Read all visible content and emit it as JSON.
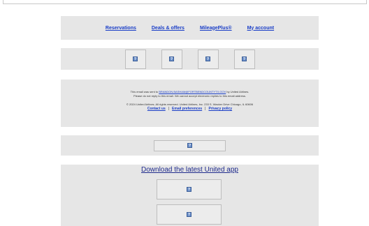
{
  "nav": {
    "items": [
      "Reservations",
      "Deals & offers",
      "MileagePlus®",
      "My account"
    ]
  },
  "footer": {
    "line1_prefix": "This email was sent to ",
    "email": "BRANDON.BASHAM@FORTBENDCOUNTYTX.GOV",
    "line1_suffix": " by United Airlines.",
    "line2": "Please do not reply to this email. We cannot accept electronic replies to this email address.",
    "copyright": "© 2024 United Airlines. All rights reserved. United Airlines, Inc. 233 S. Wacker Drive Chicago, IL 60606",
    "links": [
      "Contact us",
      "Email preferences",
      "Privacy policy"
    ],
    "separator": "|"
  },
  "app": {
    "download_text": "Download the latest United app"
  },
  "icons": {
    "broken_image": "?"
  },
  "colors": {
    "link": "#1a3ec7",
    "panel": "#e6e6e6"
  }
}
